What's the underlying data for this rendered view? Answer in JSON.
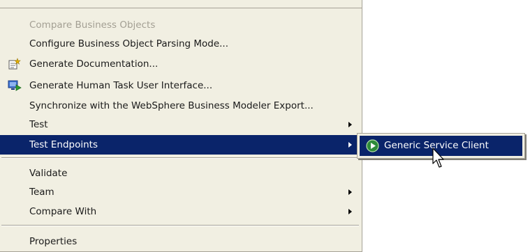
{
  "menu": {
    "items": [
      {
        "label": "Compare Business Objects",
        "disabled": true
      },
      {
        "label": "Configure Business Object Parsing Mode..."
      },
      {
        "label": "Generate Documentation...",
        "icon": "generate-documentation-icon"
      },
      {
        "label": "Generate Human Task User Interface...",
        "icon": "human-task-ui-icon"
      },
      {
        "label": "Synchronize with the WebSphere Business Modeler Export..."
      },
      {
        "label": "Test",
        "submenu": true
      },
      {
        "label": "Test Endpoints",
        "submenu": true,
        "selected": true
      },
      {
        "label": "Validate"
      },
      {
        "label": "Team",
        "submenu": true
      },
      {
        "label": "Compare With",
        "submenu": true
      },
      {
        "label": "Properties"
      }
    ]
  },
  "submenu": {
    "items": [
      {
        "label": "Generic Service Client",
        "icon": "service-client-icon",
        "selected": true
      }
    ]
  },
  "colors": {
    "menu_background": "#f1efe2",
    "selection": "#0a246a",
    "disabled_text": "#a39f93"
  }
}
